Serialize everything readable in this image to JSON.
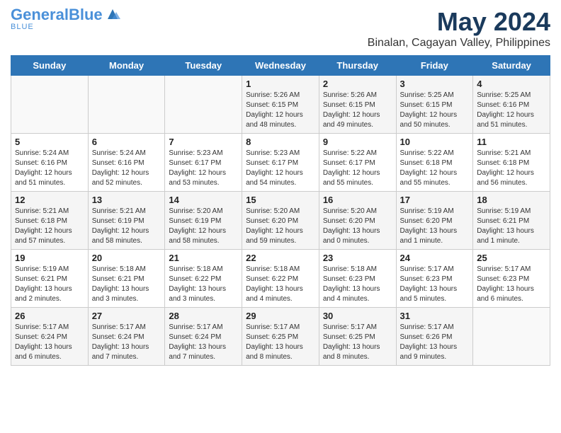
{
  "header": {
    "logo_line1": "General",
    "logo_line2": "Blue",
    "month": "May 2024",
    "location": "Binalan, Cagayan Valley, Philippines"
  },
  "days_of_week": [
    "Sunday",
    "Monday",
    "Tuesday",
    "Wednesday",
    "Thursday",
    "Friday",
    "Saturday"
  ],
  "weeks": [
    [
      {
        "day": "",
        "info": ""
      },
      {
        "day": "",
        "info": ""
      },
      {
        "day": "",
        "info": ""
      },
      {
        "day": "1",
        "info": "Sunrise: 5:26 AM\nSunset: 6:15 PM\nDaylight: 12 hours\nand 48 minutes."
      },
      {
        "day": "2",
        "info": "Sunrise: 5:26 AM\nSunset: 6:15 PM\nDaylight: 12 hours\nand 49 minutes."
      },
      {
        "day": "3",
        "info": "Sunrise: 5:25 AM\nSunset: 6:15 PM\nDaylight: 12 hours\nand 50 minutes."
      },
      {
        "day": "4",
        "info": "Sunrise: 5:25 AM\nSunset: 6:16 PM\nDaylight: 12 hours\nand 51 minutes."
      }
    ],
    [
      {
        "day": "5",
        "info": "Sunrise: 5:24 AM\nSunset: 6:16 PM\nDaylight: 12 hours\nand 51 minutes."
      },
      {
        "day": "6",
        "info": "Sunrise: 5:24 AM\nSunset: 6:16 PM\nDaylight: 12 hours\nand 52 minutes."
      },
      {
        "day": "7",
        "info": "Sunrise: 5:23 AM\nSunset: 6:17 PM\nDaylight: 12 hours\nand 53 minutes."
      },
      {
        "day": "8",
        "info": "Sunrise: 5:23 AM\nSunset: 6:17 PM\nDaylight: 12 hours\nand 54 minutes."
      },
      {
        "day": "9",
        "info": "Sunrise: 5:22 AM\nSunset: 6:17 PM\nDaylight: 12 hours\nand 55 minutes."
      },
      {
        "day": "10",
        "info": "Sunrise: 5:22 AM\nSunset: 6:18 PM\nDaylight: 12 hours\nand 55 minutes."
      },
      {
        "day": "11",
        "info": "Sunrise: 5:21 AM\nSunset: 6:18 PM\nDaylight: 12 hours\nand 56 minutes."
      }
    ],
    [
      {
        "day": "12",
        "info": "Sunrise: 5:21 AM\nSunset: 6:18 PM\nDaylight: 12 hours\nand 57 minutes."
      },
      {
        "day": "13",
        "info": "Sunrise: 5:21 AM\nSunset: 6:19 PM\nDaylight: 12 hours\nand 58 minutes."
      },
      {
        "day": "14",
        "info": "Sunrise: 5:20 AM\nSunset: 6:19 PM\nDaylight: 12 hours\nand 58 minutes."
      },
      {
        "day": "15",
        "info": "Sunrise: 5:20 AM\nSunset: 6:20 PM\nDaylight: 12 hours\nand 59 minutes."
      },
      {
        "day": "16",
        "info": "Sunrise: 5:20 AM\nSunset: 6:20 PM\nDaylight: 13 hours\nand 0 minutes."
      },
      {
        "day": "17",
        "info": "Sunrise: 5:19 AM\nSunset: 6:20 PM\nDaylight: 13 hours\nand 1 minute."
      },
      {
        "day": "18",
        "info": "Sunrise: 5:19 AM\nSunset: 6:21 PM\nDaylight: 13 hours\nand 1 minute."
      }
    ],
    [
      {
        "day": "19",
        "info": "Sunrise: 5:19 AM\nSunset: 6:21 PM\nDaylight: 13 hours\nand 2 minutes."
      },
      {
        "day": "20",
        "info": "Sunrise: 5:18 AM\nSunset: 6:21 PM\nDaylight: 13 hours\nand 3 minutes."
      },
      {
        "day": "21",
        "info": "Sunrise: 5:18 AM\nSunset: 6:22 PM\nDaylight: 13 hours\nand 3 minutes."
      },
      {
        "day": "22",
        "info": "Sunrise: 5:18 AM\nSunset: 6:22 PM\nDaylight: 13 hours\nand 4 minutes."
      },
      {
        "day": "23",
        "info": "Sunrise: 5:18 AM\nSunset: 6:23 PM\nDaylight: 13 hours\nand 4 minutes."
      },
      {
        "day": "24",
        "info": "Sunrise: 5:17 AM\nSunset: 6:23 PM\nDaylight: 13 hours\nand 5 minutes."
      },
      {
        "day": "25",
        "info": "Sunrise: 5:17 AM\nSunset: 6:23 PM\nDaylight: 13 hours\nand 6 minutes."
      }
    ],
    [
      {
        "day": "26",
        "info": "Sunrise: 5:17 AM\nSunset: 6:24 PM\nDaylight: 13 hours\nand 6 minutes."
      },
      {
        "day": "27",
        "info": "Sunrise: 5:17 AM\nSunset: 6:24 PM\nDaylight: 13 hours\nand 7 minutes."
      },
      {
        "day": "28",
        "info": "Sunrise: 5:17 AM\nSunset: 6:24 PM\nDaylight: 13 hours\nand 7 minutes."
      },
      {
        "day": "29",
        "info": "Sunrise: 5:17 AM\nSunset: 6:25 PM\nDaylight: 13 hours\nand 8 minutes."
      },
      {
        "day": "30",
        "info": "Sunrise: 5:17 AM\nSunset: 6:25 PM\nDaylight: 13 hours\nand 8 minutes."
      },
      {
        "day": "31",
        "info": "Sunrise: 5:17 AM\nSunset: 6:26 PM\nDaylight: 13 hours\nand 9 minutes."
      },
      {
        "day": "",
        "info": ""
      }
    ]
  ],
  "colors": {
    "header_bg": "#2e75b6",
    "logo_blue": "#1a3a5c",
    "logo_light_blue": "#4a90d9"
  }
}
